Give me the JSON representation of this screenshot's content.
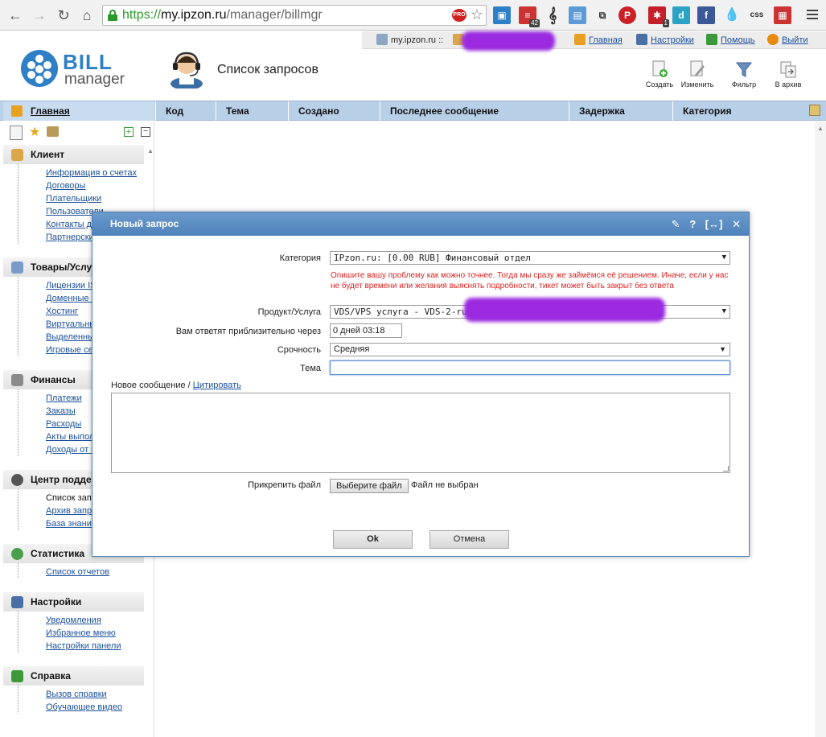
{
  "browser": {
    "url_protocol": "https://",
    "url_host": "my.ipzon.ru",
    "url_path": "/manager/billmgr",
    "ext_pro_label": "PRO",
    "ext_badge_count": "42",
    "ext_badge_small": "1",
    "ext_css_label": "css",
    "ext_d_label": "d",
    "ext_f_label": "f"
  },
  "topbar": {
    "account": "my.ipzon.ru ::",
    "links": {
      "home": "Главная",
      "settings": "Настройки",
      "help": "Помощь",
      "logout": "Выйти"
    }
  },
  "header": {
    "logo_bill": "BILL",
    "logo_manager": "manager",
    "page_title": "Список запросов",
    "toolbar": {
      "create": "Создать",
      "edit": "Изменить",
      "filter": "Фильтр",
      "archive": "В архив"
    }
  },
  "columns": {
    "home": "Главная",
    "items": [
      "Код",
      "Тема",
      "Создано",
      "Последнее сообщение",
      "Задержка",
      "Категория"
    ]
  },
  "sidebar": {
    "client": {
      "title": "Клиент",
      "items": [
        "Информация о счетах",
        "Договоры",
        "Плательщики",
        "Пользователи",
        "Контакты доме",
        "Партнерские пр"
      ]
    },
    "goods": {
      "title": "Товары/Услуги",
      "items": [
        "Лицензии ISPsy",
        "Доменные име",
        "Хостинг",
        "Виртуальные се",
        "Выделенные се",
        "Игровые серве"
      ]
    },
    "finance": {
      "title": "Финансы",
      "items": [
        "Платежи",
        "Заказы",
        "Расходы",
        "Акты выполнен",
        "Доходы от парт"
      ]
    },
    "support": {
      "title": "Центр подде",
      "items": [
        "Список запросо",
        "Архив запросо",
        "База знаний"
      ]
    },
    "stats": {
      "title": "Статистика",
      "items": [
        "Список отчетов"
      ]
    },
    "settings": {
      "title": "Настройки",
      "items": [
        "Уведомления",
        "Избранное меню",
        "Настройки панели"
      ]
    },
    "help": {
      "title": "Справка",
      "items": [
        "Вызов справки",
        "Обучающее видео"
      ]
    }
  },
  "dialog": {
    "title": "Новый запрос",
    "tools": {
      "pin": "✎",
      "help": "?",
      "expand": "[↔]",
      "close": "✕"
    },
    "category_label": "Категория",
    "category_value": "IPzon.ru: [0.00 RUB] Финансовый отдел",
    "hint": "Опишите вашу проблему как можно точнее. Тогда мы сразу же займёмся её решением. Иначе, если у нас не будет времени или желания выяснять подробности, тикет может быть закрыт без ответа",
    "product_label": "Продукт/Услуга",
    "product_value": "VDS/VPS услуга - VDS-2-ru",
    "response_label": "Вам ответят приблизительно через",
    "response_value": "0 дней 03:18",
    "urgency_label": "Срочность",
    "urgency_value": "Средняя",
    "subject_label": "Тема",
    "subject_value": "",
    "message_label": "Новое сообщение /",
    "quote_link": "Цитировать",
    "attach_label": "Прикрепить файл",
    "choose_file": "Выберите файл",
    "no_file": "Файл не выбран",
    "ok": "Ok",
    "cancel": "Отмена"
  }
}
